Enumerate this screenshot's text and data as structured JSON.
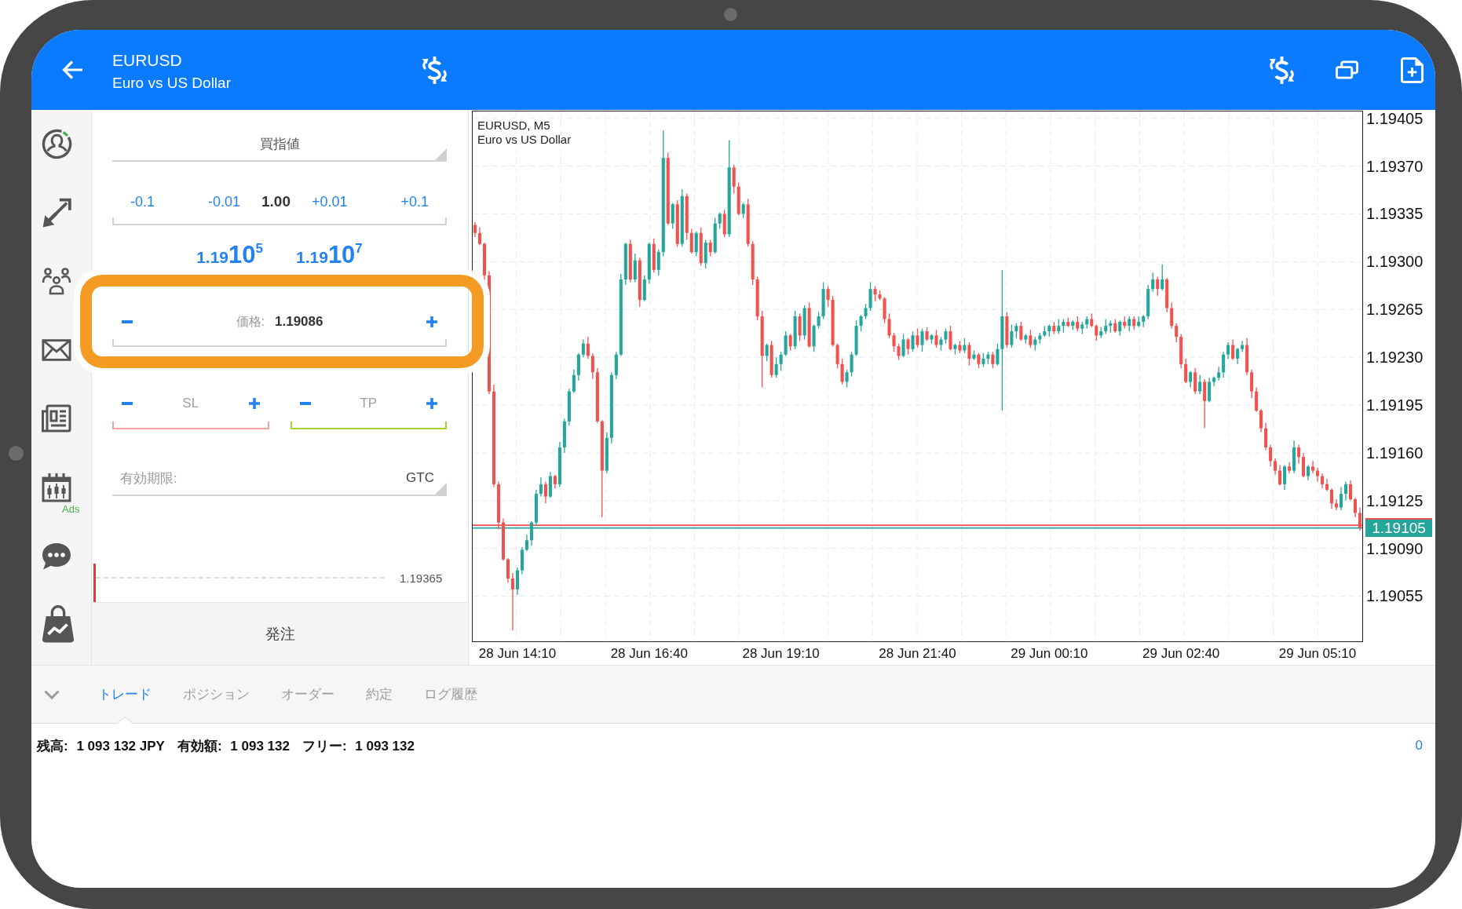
{
  "header": {
    "symbol": "EURUSD",
    "description": "Euro vs US Dollar"
  },
  "sidebar": {
    "ads_label": "Ads"
  },
  "order": {
    "type": "買指値",
    "volume": {
      "decrease": [
        "-0.1",
        "-0.01"
      ],
      "value": "1.00",
      "increase": [
        "+0.01",
        "+0.1"
      ]
    },
    "quotes": [
      {
        "head": "1.19",
        "big": "10",
        "pip": "5"
      },
      {
        "head": "1.19",
        "big": "10",
        "pip": "7"
      }
    ],
    "price": {
      "label": "価格:",
      "value": "1.19086",
      "highlighted": true
    },
    "stop_loss": {
      "label": "SL"
    },
    "take_profit": {
      "label": "TP"
    },
    "expiration": {
      "label": "有効期限:",
      "value": "GTC"
    },
    "preview": {
      "price": "1.19365"
    },
    "submit": "発注"
  },
  "chart": {
    "symbol": "EURUSD, M5",
    "description": "Euro vs US Dollar",
    "current_price": "1.19105",
    "chart_data": {
      "type": "candlestick",
      "categories": [
        null,
        null,
        null,
        null,
        null,
        null,
        null,
        null,
        null,
        "28 Jun 14:10",
        null,
        null,
        null,
        null,
        null,
        null,
        null,
        null,
        null,
        null,
        null,
        null,
        null,
        null,
        null,
        null,
        null,
        null,
        null,
        null,
        null,
        null,
        null,
        null,
        null,
        null,
        null,
        "28 Jun 16:40",
        null,
        null,
        null,
        null,
        null,
        null,
        null,
        null,
        null,
        null,
        null,
        null,
        null,
        null,
        null,
        null,
        null,
        null,
        null,
        null,
        null,
        null,
        null,
        null,
        null,
        null,
        null,
        "28 Jun 19:10",
        null,
        null,
        null,
        null,
        null,
        null,
        null,
        null,
        null,
        null,
        null,
        null,
        null,
        null,
        null,
        null,
        null,
        null,
        null,
        null,
        null,
        null,
        null,
        null,
        null,
        null,
        null,
        null,
        "28 Jun 21:40",
        null,
        null,
        null,
        null,
        null,
        null,
        null,
        null,
        null,
        null,
        null,
        null,
        null,
        null,
        null,
        null,
        null,
        null,
        null,
        null,
        null,
        null,
        null,
        null,
        null,
        null,
        null,
        "29 Jun 00:10",
        null,
        null,
        null,
        null,
        null,
        null,
        null,
        null,
        null,
        null,
        null,
        null,
        null,
        null,
        null,
        null,
        null,
        null,
        null,
        null,
        null,
        null,
        null,
        null,
        null,
        null,
        null,
        "29 Jun 02:40",
        null,
        null,
        null,
        null,
        null,
        null,
        null,
        null,
        null,
        null,
        null,
        null,
        null,
        null,
        null,
        null,
        null,
        null,
        null,
        null,
        null,
        null,
        null,
        null,
        null,
        null,
        null,
        null,
        "29 Jun 05:10",
        null,
        null,
        null,
        null,
        null,
        null,
        null,
        null,
        null
      ],
      "ohlc": [
        [
          1.19327,
          1.19329,
          1.19318,
          1.19321
        ],
        [
          1.19321,
          1.19325,
          1.19312,
          1.19313
        ],
        [
          1.19313,
          1.19314,
          1.19286,
          1.1929
        ],
        [
          1.1929,
          1.19293,
          1.19203,
          1.19205
        ],
        [
          1.19205,
          1.1921,
          1.19135,
          1.19137
        ],
        [
          1.19137,
          1.19139,
          1.19104,
          1.19109
        ],
        [
          1.19109,
          1.19112,
          1.19081,
          1.19082
        ],
        [
          1.19082,
          1.19083,
          1.19065,
          1.19068
        ],
        [
          1.19068,
          1.19072,
          1.1903,
          1.1906
        ],
        [
          1.1906,
          1.19076,
          1.19056,
          1.19074
        ],
        [
          1.19074,
          1.19091,
          1.19071,
          1.19089
        ],
        [
          1.19089,
          1.191,
          1.19088,
          1.19096
        ],
        [
          1.19096,
          1.1911,
          1.19092,
          1.19109
        ],
        [
          1.19109,
          1.19133,
          1.19107,
          1.1913
        ],
        [
          1.1913,
          1.19142,
          1.19128,
          1.19137
        ],
        [
          1.19137,
          1.19139,
          1.19123,
          1.19128
        ],
        [
          1.19128,
          1.19146,
          1.19127,
          1.19143
        ],
        [
          1.19143,
          1.19144,
          1.19134,
          1.19137
        ],
        [
          1.19137,
          1.19168,
          1.19135,
          1.19164
        ],
        [
          1.19164,
          1.19185,
          1.1916,
          1.19183
        ],
        [
          1.19183,
          1.19207,
          1.1918,
          1.19205
        ],
        [
          1.19205,
          1.19221,
          1.19204,
          1.19217
        ],
        [
          1.19217,
          1.19233,
          1.19213,
          1.19232
        ],
        [
          1.19232,
          1.19243,
          1.1923,
          1.1924
        ],
        [
          1.1924,
          1.19245,
          1.19229,
          1.19231
        ],
        [
          1.19231,
          1.19233,
          1.19214,
          1.19219
        ],
        [
          1.19219,
          1.19222,
          1.19182,
          1.19183
        ],
        [
          1.19183,
          1.19184,
          1.19113,
          1.19147
        ],
        [
          1.19147,
          1.19175,
          1.19145,
          1.19171
        ],
        [
          1.19171,
          1.19219,
          1.19167,
          1.19217
        ],
        [
          1.19217,
          1.19234,
          1.19214,
          1.19232
        ],
        [
          1.19232,
          1.19291,
          1.19231,
          1.19287
        ],
        [
          1.19287,
          1.19314,
          1.19283,
          1.19313
        ],
        [
          1.19313,
          1.19316,
          1.19285,
          1.19287
        ],
        [
          1.19287,
          1.19306,
          1.19285,
          1.19301
        ],
        [
          1.19301,
          1.19303,
          1.19267,
          1.19272
        ],
        [
          1.19272,
          1.1929,
          1.19271,
          1.19287
        ],
        [
          1.19287,
          1.19314,
          1.19284,
          1.19313
        ],
        [
          1.19313,
          1.19317,
          1.19292,
          1.19294
        ],
        [
          1.19294,
          1.19309,
          1.1929,
          1.19307
        ],
        [
          1.19307,
          1.19396,
          1.19304,
          1.19376
        ],
        [
          1.19376,
          1.1938,
          1.19327,
          1.19328
        ],
        [
          1.19328,
          1.19343,
          1.19324,
          1.19342
        ],
        [
          1.19342,
          1.19345,
          1.19311,
          1.19313
        ],
        [
          1.19313,
          1.19353,
          1.19311,
          1.19348
        ],
        [
          1.19348,
          1.1935,
          1.19316,
          1.19321
        ],
        [
          1.19321,
          1.19324,
          1.19306,
          1.19307
        ],
        [
          1.19307,
          1.19322,
          1.19304,
          1.19321
        ],
        [
          1.19321,
          1.19325,
          1.19297,
          1.19299
        ],
        [
          1.19299,
          1.19316,
          1.19295,
          1.19314
        ],
        [
          1.19314,
          1.19316,
          1.19304,
          1.19307
        ],
        [
          1.19307,
          1.19332,
          1.19306,
          1.19328
        ],
        [
          1.19328,
          1.19336,
          1.19324,
          1.19335
        ],
        [
          1.19335,
          1.19338,
          1.19318,
          1.1932
        ],
        [
          1.1932,
          1.19389,
          1.19318,
          1.19369
        ],
        [
          1.19369,
          1.19371,
          1.1935,
          1.19355
        ],
        [
          1.19355,
          1.19358,
          1.19334,
          1.19335
        ],
        [
          1.19335,
          1.19343,
          1.19332,
          1.19342
        ],
        [
          1.19342,
          1.19346,
          1.19311,
          1.19313
        ],
        [
          1.19313,
          1.19315,
          1.19283,
          1.19287
        ],
        [
          1.19287,
          1.19289,
          1.19257,
          1.1926
        ],
        [
          1.1926,
          1.19264,
          1.19208,
          1.19231
        ],
        [
          1.19231,
          1.1924,
          1.19227,
          1.19239
        ],
        [
          1.19239,
          1.19242,
          1.19215,
          1.19217
        ],
        [
          1.19217,
          1.1923,
          1.19215,
          1.19225
        ],
        [
          1.19225,
          1.19234,
          1.1922,
          1.19232
        ],
        [
          1.19232,
          1.19249,
          1.19231,
          1.19246
        ],
        [
          1.19246,
          1.19247,
          1.19235,
          1.19238
        ],
        [
          1.19238,
          1.19264,
          1.19236,
          1.1926
        ],
        [
          1.1926,
          1.19262,
          1.19242,
          1.19246
        ],
        [
          1.19246,
          1.19268,
          1.19243,
          1.19266
        ],
        [
          1.19266,
          1.1927,
          1.19237,
          1.19238
        ],
        [
          1.19238,
          1.19254,
          1.19234,
          1.19253
        ],
        [
          1.19253,
          1.19263,
          1.19251,
          1.1926
        ],
        [
          1.1926,
          1.19285,
          1.19258,
          1.1928
        ],
        [
          1.1928,
          1.19282,
          1.19267,
          1.19272
        ],
        [
          1.19272,
          1.19275,
          1.19238,
          1.19239
        ],
        [
          1.19239,
          1.1924,
          1.19222,
          1.19225
        ],
        [
          1.19225,
          1.19229,
          1.1921,
          1.19212
        ],
        [
          1.19212,
          1.19221,
          1.19208,
          1.19219
        ],
        [
          1.19219,
          1.19234,
          1.19216,
          1.19232
        ],
        [
          1.19232,
          1.19257,
          1.19231,
          1.19253
        ],
        [
          1.19253,
          1.19261,
          1.19249,
          1.1926
        ],
        [
          1.1926,
          1.19269,
          1.19258,
          1.19266
        ],
        [
          1.19266,
          1.19285,
          1.19264,
          1.1928
        ],
        [
          1.1928,
          1.19282,
          1.19271,
          1.19276
        ],
        [
          1.19276,
          1.19279,
          1.19272,
          1.19273
        ],
        [
          1.19273,
          1.19274,
          1.19255,
          1.19258
        ],
        [
          1.19258,
          1.19262,
          1.19244,
          1.19246
        ],
        [
          1.19246,
          1.19248,
          1.19234,
          1.19238
        ],
        [
          1.19238,
          1.1924,
          1.19228,
          1.19231
        ],
        [
          1.19231,
          1.19247,
          1.1923,
          1.19243
        ],
        [
          1.19243,
          1.19244,
          1.19232,
          1.19236
        ],
        [
          1.19236,
          1.19249,
          1.19234,
          1.19246
        ],
        [
          1.19246,
          1.19251,
          1.19237,
          1.19239
        ],
        [
          1.19239,
          1.19251,
          1.19234,
          1.19249
        ],
        [
          1.19249,
          1.19252,
          1.19242,
          1.19243
        ],
        [
          1.19243,
          1.19247,
          1.1924,
          1.19246
        ],
        [
          1.19246,
          1.1925,
          1.19237,
          1.19239
        ],
        [
          1.19239,
          1.19245,
          1.19235,
          1.19243
        ],
        [
          1.19243,
          1.19251,
          1.1924,
          1.19249
        ],
        [
          1.19249,
          1.19253,
          1.19235,
          1.19236
        ],
        [
          1.19236,
          1.1924,
          1.19232,
          1.19239
        ],
        [
          1.19239,
          1.19242,
          1.19233,
          1.19235
        ],
        [
          1.19235,
          1.19244,
          1.19233,
          1.19239
        ],
        [
          1.19239,
          1.19241,
          1.19224,
          1.19229
        ],
        [
          1.19229,
          1.19235,
          1.19228,
          1.19232
        ],
        [
          1.19232,
          1.19233,
          1.19222,
          1.19225
        ],
        [
          1.19225,
          1.19233,
          1.19223,
          1.19229
        ],
        [
          1.19229,
          1.19234,
          1.19225,
          1.19232
        ],
        [
          1.19232,
          1.19234,
          1.19222,
          1.19225
        ],
        [
          1.19225,
          1.1924,
          1.19224,
          1.19236
        ],
        [
          1.19236,
          1.19294,
          1.19191,
          1.1926
        ],
        [
          1.1926,
          1.19263,
          1.19237,
          1.19239
        ],
        [
          1.19239,
          1.19254,
          1.19237,
          1.19249
        ],
        [
          1.19249,
          1.19255,
          1.19244,
          1.19253
        ],
        [
          1.19253,
          1.19256,
          1.19242,
          1.19243
        ],
        [
          1.19243,
          1.19247,
          1.1924,
          1.19246
        ],
        [
          1.19246,
          1.1925,
          1.19237,
          1.19239
        ],
        [
          1.19239,
          1.19245,
          1.19235,
          1.19243
        ],
        [
          1.19243,
          1.19248,
          1.1924,
          1.19246
        ],
        [
          1.19246,
          1.19253,
          1.19245,
          1.19249
        ],
        [
          1.19249,
          1.19254,
          1.19245,
          1.19253
        ],
        [
          1.19253,
          1.19256,
          1.19247,
          1.19249
        ],
        [
          1.19249,
          1.19258,
          1.19247,
          1.19253
        ],
        [
          1.19253,
          1.19258,
          1.19248,
          1.19256
        ],
        [
          1.19256,
          1.19259,
          1.19252,
          1.19253
        ],
        [
          1.19253,
          1.19257,
          1.1925,
          1.19256
        ],
        [
          1.19256,
          1.1926,
          1.19249,
          1.19251
        ],
        [
          1.19251,
          1.19256,
          1.19247,
          1.19254
        ],
        [
          1.19254,
          1.1926,
          1.19251,
          1.19258
        ],
        [
          1.19258,
          1.19262,
          1.19252,
          1.19253
        ],
        [
          1.19253,
          1.19254,
          1.19242,
          1.19246
        ],
        [
          1.19246,
          1.19252,
          1.19244,
          1.19249
        ],
        [
          1.19249,
          1.19258,
          1.19247,
          1.19253
        ],
        [
          1.19253,
          1.19257,
          1.19248,
          1.19255
        ],
        [
          1.19255,
          1.19258,
          1.19248,
          1.19249
        ],
        [
          1.19249,
          1.19257,
          1.19246,
          1.19256
        ],
        [
          1.19256,
          1.1926,
          1.19251,
          1.19253
        ],
        [
          1.19253,
          1.1926,
          1.19249,
          1.19258
        ],
        [
          1.19258,
          1.1926,
          1.1925,
          1.19253
        ],
        [
          1.19253,
          1.1926,
          1.19252,
          1.19256
        ],
        [
          1.19256,
          1.19261,
          1.19252,
          1.1926
        ],
        [
          1.1926,
          1.19283,
          1.19258,
          1.1928
        ],
        [
          1.1928,
          1.19292,
          1.19278,
          1.19287
        ],
        [
          1.19287,
          1.19289,
          1.19275,
          1.1928
        ],
        [
          1.1928,
          1.19298,
          1.19279,
          1.19287
        ],
        [
          1.19287,
          1.19288,
          1.19263,
          1.19266
        ],
        [
          1.19266,
          1.1927,
          1.19251,
          1.19253
        ],
        [
          1.19253,
          1.19255,
          1.19241,
          1.19245
        ],
        [
          1.19245,
          1.19247,
          1.19222,
          1.19225
        ],
        [
          1.19225,
          1.19229,
          1.19211,
          1.19212
        ],
        [
          1.19212,
          1.1922,
          1.19208,
          1.19219
        ],
        [
          1.19219,
          1.19222,
          1.19203,
          1.19205
        ],
        [
          1.19205,
          1.19217,
          1.19203,
          1.19212
        ],
        [
          1.19212,
          1.19214,
          1.19178,
          1.19198
        ],
        [
          1.19198,
          1.19215,
          1.19197,
          1.19212
        ],
        [
          1.19212,
          1.19216,
          1.19209,
          1.19215
        ],
        [
          1.19215,
          1.19223,
          1.19213,
          1.19219
        ],
        [
          1.19219,
          1.19234,
          1.19215,
          1.19232
        ],
        [
          1.19232,
          1.19241,
          1.19229,
          1.19239
        ],
        [
          1.19239,
          1.19243,
          1.19228,
          1.19229
        ],
        [
          1.19229,
          1.19237,
          1.19225,
          1.19236
        ],
        [
          1.19236,
          1.19242,
          1.19234,
          1.19239
        ],
        [
          1.19239,
          1.19244,
          1.19217,
          1.19219
        ],
        [
          1.19219,
          1.19221,
          1.192,
          1.19205
        ],
        [
          1.19205,
          1.19208,
          1.1919,
          1.19191
        ],
        [
          1.19191,
          1.19192,
          1.19175,
          1.19178
        ],
        [
          1.19178,
          1.19182,
          1.19162,
          1.19164
        ],
        [
          1.19164,
          1.19166,
          1.1915,
          1.19154
        ],
        [
          1.19154,
          1.19156,
          1.19144,
          1.19147
        ],
        [
          1.19147,
          1.19151,
          1.19136,
          1.19137
        ],
        [
          1.19137,
          1.19151,
          1.19133,
          1.1915
        ],
        [
          1.1915,
          1.19153,
          1.19145,
          1.19147
        ],
        [
          1.19147,
          1.19169,
          1.19145,
          1.19164
        ],
        [
          1.19164,
          1.19166,
          1.19152,
          1.19157
        ],
        [
          1.19157,
          1.1916,
          1.19142,
          1.19143
        ],
        [
          1.19143,
          1.19151,
          1.1914,
          1.1915
        ],
        [
          1.1915,
          1.19154,
          1.19145,
          1.19147
        ],
        [
          1.19147,
          1.19149,
          1.19139,
          1.19143
        ],
        [
          1.19143,
          1.19145,
          1.19134,
          1.19137
        ],
        [
          1.19137,
          1.19141,
          1.19132,
          1.19133
        ],
        [
          1.19133,
          1.19134,
          1.19119,
          1.19123
        ],
        [
          1.19123,
          1.19126,
          1.19118,
          1.1912
        ],
        [
          1.1912,
          1.19135,
          1.19118,
          1.1913
        ],
        [
          1.1913,
          1.19139,
          1.19125,
          1.19137
        ],
        [
          1.19137,
          1.1914,
          1.19125,
          1.19126
        ],
        [
          1.19126,
          1.19127,
          1.19113,
          1.19116
        ],
        [
          1.19116,
          1.1912,
          1.19103,
          1.19105
        ]
      ],
      "ylim": [
        1.19022,
        1.1941
      ],
      "yticks": [
        {
          "value": 1.19405,
          "label": "1.19405"
        },
        {
          "value": 1.1937,
          "label": "1.19370"
        },
        {
          "value": 1.19335,
          "label": "1.19335"
        },
        {
          "value": 1.193,
          "label": "1.19300"
        },
        {
          "value": 1.19265,
          "label": "1.19265"
        },
        {
          "value": 1.1923,
          "label": "1.19230"
        },
        {
          "value": 1.19195,
          "label": "1.19195"
        },
        {
          "value": 1.1916,
          "label": "1.19160"
        },
        {
          "value": 1.19125,
          "label": "1.19125"
        },
        {
          "value": 1.1909,
          "label": "1.19090"
        },
        {
          "value": 1.19055,
          "label": "1.19055"
        }
      ],
      "grid": true,
      "ref_lines": [
        {
          "axis": "y",
          "value": 1.19107,
          "color": "#ef5350"
        },
        {
          "axis": "y",
          "value": 1.19105,
          "color": "#26a69a"
        }
      ]
    }
  },
  "tabs": [
    {
      "label": "トレード",
      "selected": true
    },
    {
      "label": "ポジション",
      "selected": false
    },
    {
      "label": "オーダー",
      "selected": false
    },
    {
      "label": "約定",
      "selected": false
    },
    {
      "label": "ログ履歴",
      "selected": false
    }
  ],
  "status_bar": {
    "items": [
      {
        "label": "残高:",
        "value": "1 093 132 JPY"
      },
      {
        "label": "有効額:",
        "value": "1 093 132"
      },
      {
        "label": "フリー:",
        "value": "1 093 132"
      }
    ],
    "right_value": "0"
  }
}
